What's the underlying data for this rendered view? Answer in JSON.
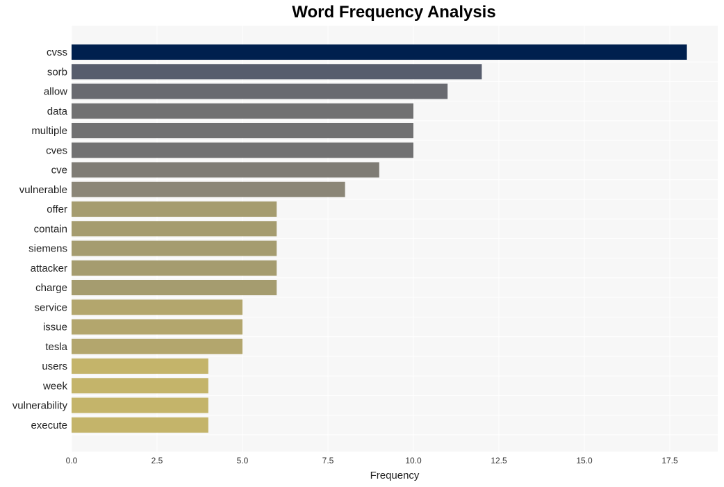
{
  "chart_data": {
    "type": "bar",
    "orientation": "horizontal",
    "title": "Word Frequency Analysis",
    "xlabel": "Frequency",
    "ylabel": "",
    "xlim": [
      0,
      18.9
    ],
    "xticks": [
      "0.0",
      "2.5",
      "5.0",
      "7.5",
      "10.0",
      "12.5",
      "15.0",
      "17.5"
    ],
    "xtick_values": [
      0,
      2.5,
      5,
      7.5,
      10,
      12.5,
      15,
      17.5
    ],
    "grid": true,
    "categories": [
      "cvss",
      "sorb",
      "allow",
      "data",
      "multiple",
      "cves",
      "cve",
      "vulnerable",
      "offer",
      "contain",
      "siemens",
      "attacker",
      "charge",
      "service",
      "issue",
      "tesla",
      "users",
      "week",
      "vulnerability",
      "execute"
    ],
    "values": [
      18,
      12,
      11,
      10,
      10,
      10,
      9,
      8,
      6,
      6,
      6,
      6,
      6,
      5,
      5,
      5,
      4,
      4,
      4,
      4
    ],
    "colors": [
      "#00204e",
      "#575d6d",
      "#696a70",
      "#717172",
      "#717172",
      "#717172",
      "#7f7c75",
      "#8b8677",
      "#a59c6f",
      "#a59c6f",
      "#a59c6f",
      "#a59c6f",
      "#a59c6f",
      "#b3a66d",
      "#b3a66d",
      "#b3a66d",
      "#c4b46a",
      "#c4b46a",
      "#c4b46a",
      "#c4b46a"
    ]
  }
}
